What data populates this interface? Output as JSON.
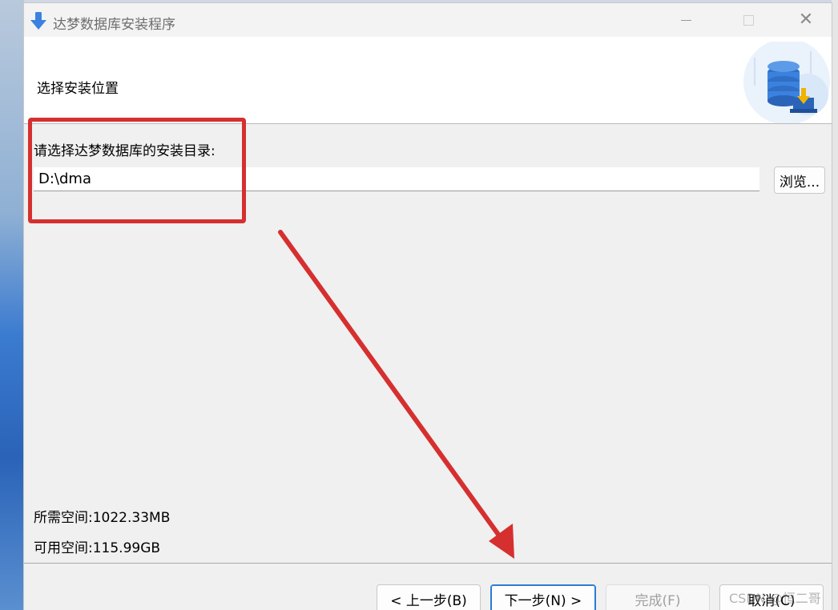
{
  "window": {
    "title": "达梦数据库安装程序"
  },
  "header": {
    "title": "选择安装位置"
  },
  "install_location": {
    "prompt": "请选择达梦数据库的安装目录:",
    "path_value": "D:\\dma",
    "browse_label": "浏览..."
  },
  "space": {
    "required": "所需空间:1022.33MB",
    "available": "可用空间:115.99GB"
  },
  "buttons": {
    "back": "< 上一步(B)",
    "next": "下一步(N) >",
    "finish": "完成(F)",
    "cancel": "取消(C)"
  },
  "watermark": "CSDN @恒二哥",
  "colors": {
    "annotation_red": "#d62f2f",
    "primary_focus": "#2c7bd6",
    "title_icon": "#3b82e0"
  }
}
